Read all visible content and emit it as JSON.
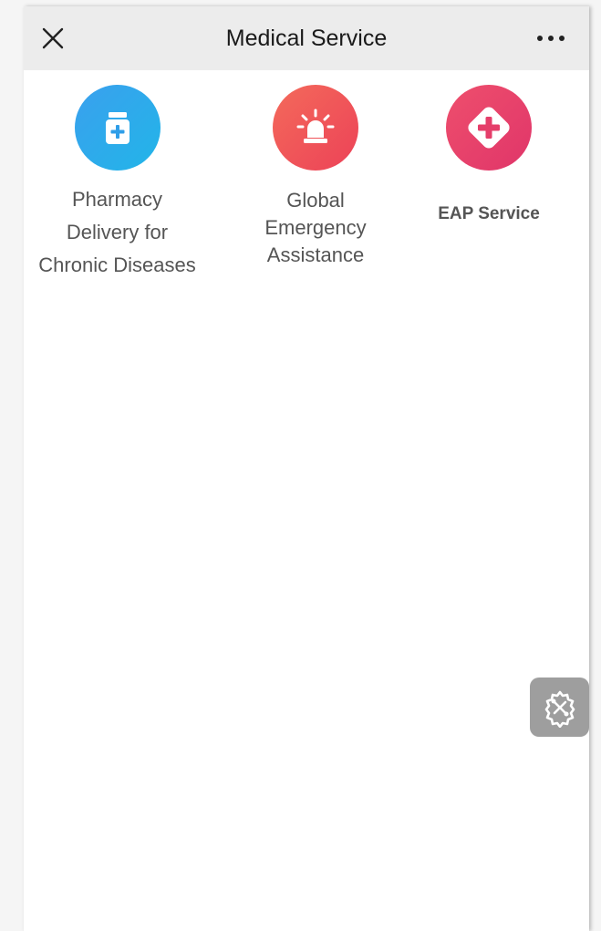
{
  "header": {
    "title": "Medical Service",
    "close_icon": "close-icon",
    "more_icon": "more-dots-icon"
  },
  "services": [
    {
      "id": "pharmacy",
      "label_lines": [
        "Pharmacy",
        "Delivery for",
        "Chronic Diseases"
      ],
      "icon": "medicine-bottle-icon",
      "color": "#2f9ee8"
    },
    {
      "id": "emergency",
      "label_lines": [
        "Global",
        "Emergency",
        "Assistance"
      ],
      "icon": "siren-icon",
      "color": "#f0574f"
    },
    {
      "id": "eap",
      "label_lines": [
        "EAP Service"
      ],
      "icon": "medical-cross-icon",
      "color": "#e53e6a"
    }
  ],
  "floating": {
    "tools_icon": "tools-gear-icon",
    "background": "#9e9e9e"
  }
}
